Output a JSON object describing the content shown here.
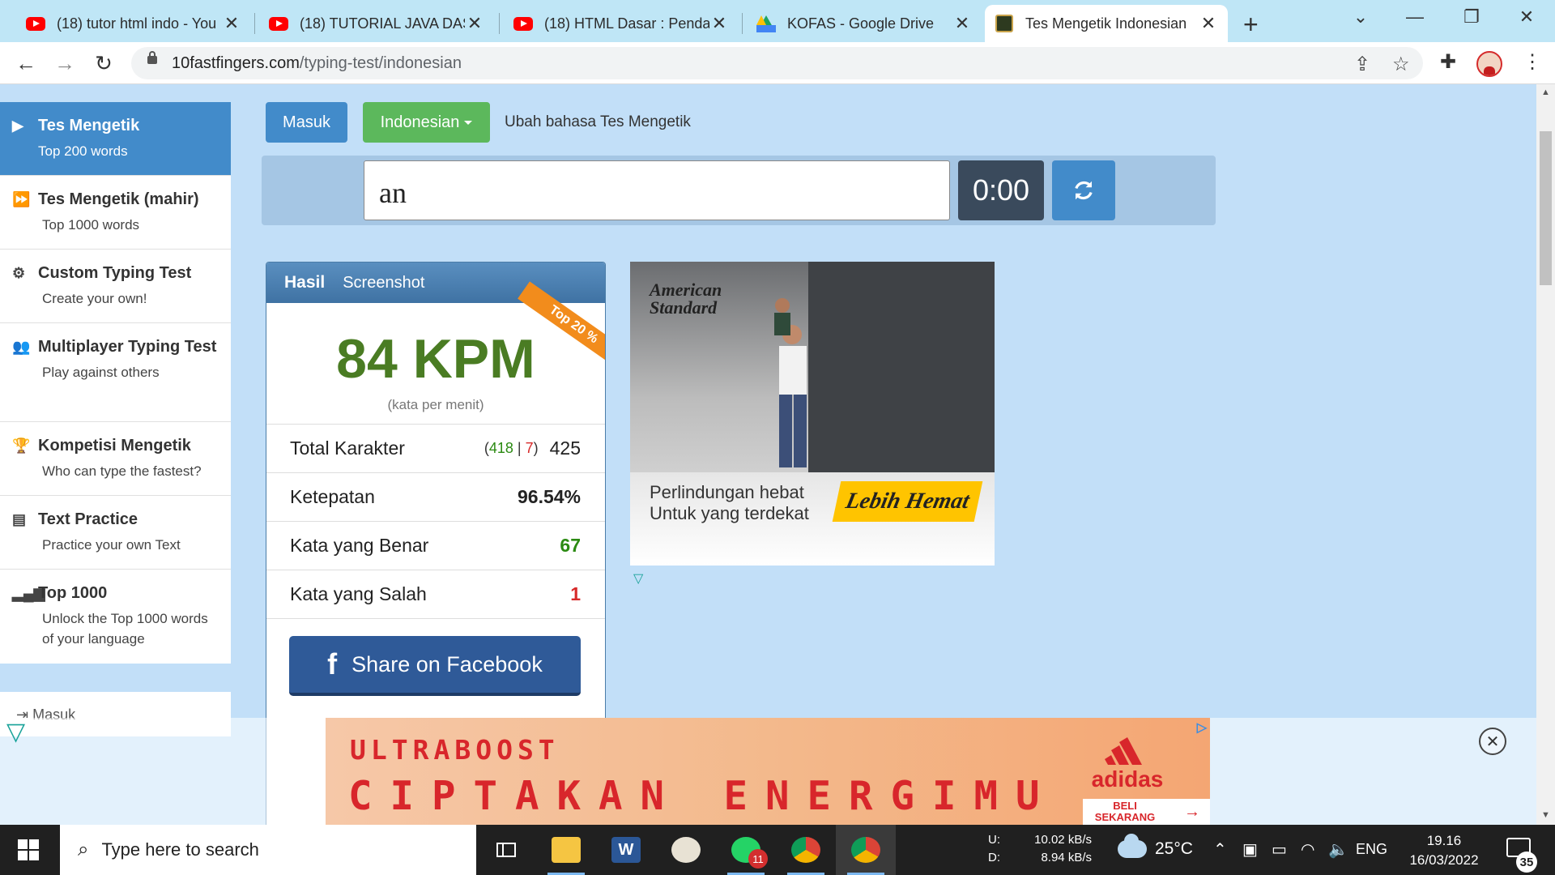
{
  "browser": {
    "tabs": [
      {
        "label": "(18) tutor html indo - You",
        "icon": "youtube-icon",
        "active": false
      },
      {
        "label": "(18) TUTORIAL JAVA DASA",
        "icon": "youtube-icon",
        "active": false
      },
      {
        "label": "(18) HTML Dasar : Pendah",
        "icon": "youtube-icon",
        "active": false
      },
      {
        "label": "KOFAS - Google Drive",
        "icon": "google-drive-icon",
        "active": false
      },
      {
        "label": "Tes Mengetik Indonesian",
        "icon": "10fastfingers-icon",
        "active": true
      }
    ],
    "url_host": "10fastfingers.com",
    "url_path": "/typing-test/indonesian"
  },
  "page": {
    "login_button": "Masuk",
    "language_button": "Indonesian",
    "language_hint": "Ubah bahasa Tes Mengetik",
    "typing_value": "an",
    "timer": "0:00"
  },
  "sidebar": {
    "items": [
      {
        "title": "Tes Mengetik",
        "sub": "Top 200 words",
        "icon": "play-icon"
      },
      {
        "title": "Tes Mengetik (mahir)",
        "sub": "Top 1000 words",
        "icon": "fast-forward-icon"
      },
      {
        "title": "Custom Typing Test",
        "sub": "Create your own!",
        "icon": "gears-icon"
      },
      {
        "title": "Multiplayer Typing Test",
        "sub": "Play against others",
        "icon": "users-icon"
      },
      {
        "title": "Kompetisi Mengetik",
        "sub": "Who can type the fastest?",
        "icon": "trophy-icon"
      },
      {
        "title": "Text Practice",
        "sub": "Practice your own Text",
        "icon": "document-icon"
      },
      {
        "title": "Top 1000",
        "sub": "Unlock the Top 1000 words of your language",
        "icon": "signal-bars-icon"
      }
    ],
    "login": "Masuk"
  },
  "results": {
    "tab_result": "Hasil",
    "tab_screenshot": "Screenshot",
    "badge": "Top 20 %",
    "wpm": "84 KPM",
    "wpm_sub": "(kata per menit)",
    "rows": [
      {
        "label": "Total Karakter",
        "value": "425"
      },
      {
        "label": "Ketepatan",
        "value": "96.54%"
      },
      {
        "label": "Kata yang Benar",
        "value": "67"
      },
      {
        "label": "Kata yang Salah",
        "value": "1"
      }
    ],
    "keys_correct": "418",
    "keys_wrong": "7",
    "share_button": "Share on Facebook"
  },
  "ad_side": {
    "brand": "American Standard",
    "line1": "Perlindungan hebat",
    "line2": "Untuk yang terdekat",
    "cta": "Lebih Hemat"
  },
  "ad_banner": {
    "title": "ULTRABOOST",
    "headline": "CIPTAKAN ENERGIMU",
    "brand": "adidas",
    "cta": "BELI SEKARANG"
  },
  "taskbar": {
    "search_placeholder": "Type here to search",
    "upload_label": "U:",
    "download_label": "D:",
    "upload": "10.02 kB/s",
    "download": "8.94 kB/s",
    "temperature": "25°C",
    "language": "ENG",
    "time": "19.16",
    "date": "16/03/2022",
    "notifications": "35",
    "whatsapp_badge": "11"
  }
}
